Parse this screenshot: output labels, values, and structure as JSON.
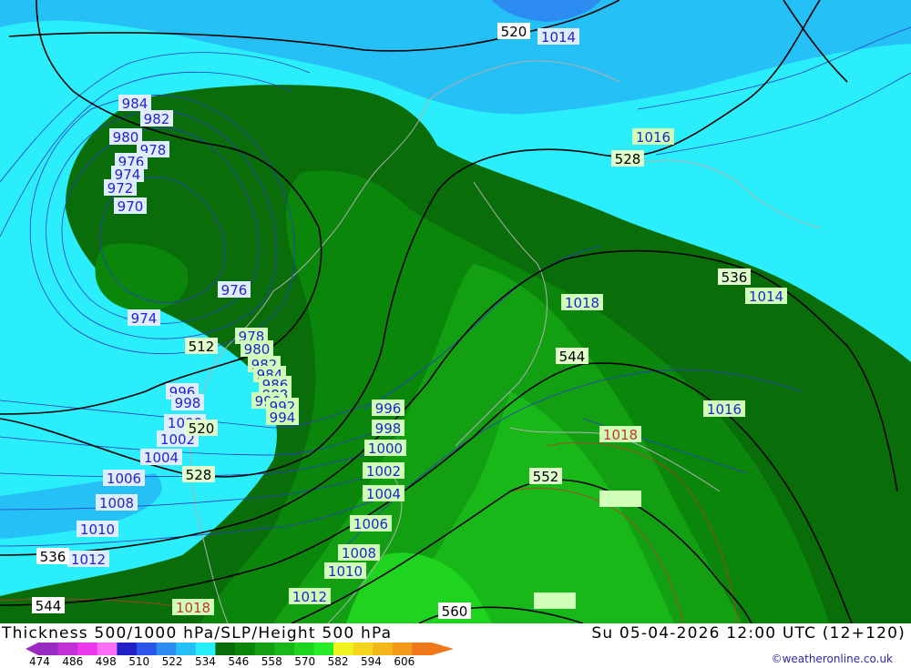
{
  "title_left": "Thickness 500/1000 hPa/SLP/Height 500 hPa",
  "title_right": "Su 05-04-2026 12:00 UTC (12+120)",
  "credit": "©weatheronline.co.uk",
  "legend": {
    "ticks": [
      "474",
      "486",
      "498",
      "510",
      "522",
      "534",
      "546",
      "558",
      "570",
      "582",
      "594",
      "606"
    ],
    "colors": [
      "#9a2bc2",
      "#c42fd6",
      "#ec39ec",
      "#fb6ff7",
      "#2120c6",
      "#2a55e8",
      "#2c8cf2",
      "#24c0f6",
      "#2aeefb",
      "#096e09",
      "#0a860a",
      "#12a012",
      "#17b817",
      "#1ed41e",
      "#27ec27",
      "#f0f21d",
      "#f4d51c",
      "#f4b71a",
      "#f49a1a",
      "#f07818"
    ]
  },
  "labels": {
    "slp": [
      "984",
      "982",
      "980",
      "978",
      "976",
      "974",
      "972",
      "970",
      "976",
      "974",
      "978",
      "980",
      "982",
      "984",
      "986",
      "988",
      "990",
      "992",
      "994",
      "996",
      "998",
      "1000",
      "1002",
      "1004",
      "1006",
      "1008",
      "1010",
      "1012",
      "1004",
      "1006",
      "1008",
      "1010",
      "1012",
      "1014",
      "1016",
      "1018",
      "1014",
      "1016",
      "1018"
    ],
    "height": [
      "520",
      "528",
      "536",
      "544",
      "552",
      "560",
      "512",
      "520",
      "528",
      "536",
      "544"
    ]
  },
  "colors": {
    "slp_text": "#2424cc",
    "slp_text_warm": "#c8342c",
    "label_bg_cool": "#e0ecff",
    "label_bg_green": "#cfffb8",
    "height_line": "#000000"
  }
}
